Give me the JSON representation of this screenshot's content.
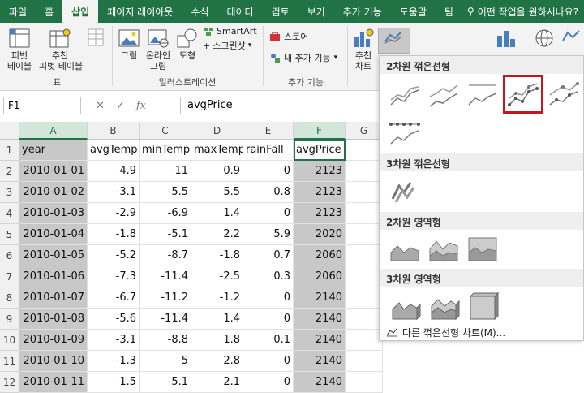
{
  "tabs": [
    "파일",
    "홈",
    "삽입",
    "페이지 레이아웃",
    "수식",
    "데이터",
    "검토",
    "보기",
    "추가 기능",
    "도움말",
    "팀"
  ],
  "active_tab_index": 2,
  "tell_me": "어떤 작업을 원하시나요?",
  "ribbon": {
    "pivot_table": "피벗\n테이블",
    "recommended_pivot": "추천\n피벗 테이블",
    "group_table": "표",
    "picture": "그림",
    "online_picture": "온라인\n그림",
    "shapes": "도형",
    "smartart": "SmartArt",
    "screenshot": "스크린샷",
    "group_illustrations": "일러스트레이션",
    "store": "스토어",
    "my_addins": "내 추가 기능",
    "group_addins": "추가 기능",
    "recommended_charts": "추천\n차트",
    "pivot_chart": "피벗 차트",
    "map3d": "3D 맵",
    "line_spark": "꺾은선형"
  },
  "formula_bar": {
    "name_box": "F1",
    "formula": "avgPrice",
    "fx": "fx"
  },
  "columns": [
    "A",
    "B",
    "C",
    "D",
    "E",
    "F",
    "G"
  ],
  "rows": [
    [
      "year",
      "avgTemp",
      "minTemp",
      "maxTemp",
      "rainFall",
      "avgPrice"
    ],
    [
      "2010-01-01",
      "-4.9",
      "-11",
      "0.9",
      "0",
      "2123"
    ],
    [
      "2010-01-02",
      "-3.1",
      "-5.5",
      "5.5",
      "0.8",
      "2123"
    ],
    [
      "2010-01-03",
      "-2.9",
      "-6.9",
      "1.4",
      "0",
      "2123"
    ],
    [
      "2010-01-04",
      "-1.8",
      "-5.1",
      "2.2",
      "5.9",
      "2020"
    ],
    [
      "2010-01-05",
      "-5.2",
      "-8.7",
      "-1.8",
      "0.7",
      "2060"
    ],
    [
      "2010-01-06",
      "-7.3",
      "-11.4",
      "-2.5",
      "0.3",
      "2060"
    ],
    [
      "2010-01-07",
      "-6.7",
      "-11.2",
      "-1.2",
      "0",
      "2140"
    ],
    [
      "2010-01-08",
      "-5.6",
      "-11.4",
      "1.4",
      "0",
      "2140"
    ],
    [
      "2010-01-09",
      "-3.1",
      "-8.8",
      "1.8",
      "0.1",
      "2140"
    ],
    [
      "2010-01-10",
      "-1.3",
      "-5",
      "2.8",
      "0",
      "2140"
    ],
    [
      "2010-01-11",
      "-1.5",
      "-5.1",
      "2.1",
      "0",
      "2140"
    ]
  ],
  "panel": {
    "section_2d_line": "2차원 꺾은선형",
    "section_3d_line": "3차원 꺾은선형",
    "section_2d_area": "2차원 영역형",
    "section_3d_area": "3차원 영역형",
    "more_charts": "다른 꺾은선형 차트(M)..."
  },
  "colors": {
    "excel_green": "#217346",
    "highlight_red": "#c4161c",
    "chart_line": "#6f6f6f"
  }
}
